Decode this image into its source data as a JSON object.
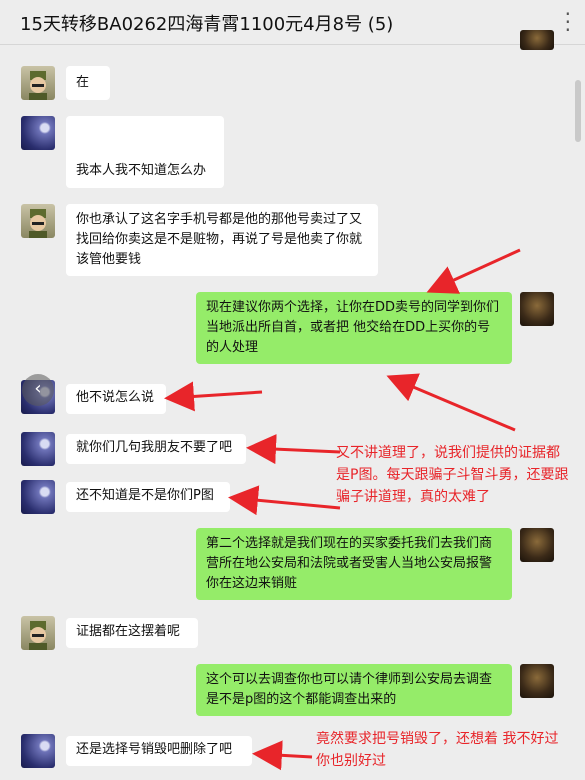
{
  "title": "15天转移BA0262四海青霄1100元4月8号 (5)",
  "menu_icon": "more-dots-icon",
  "messages": [
    {
      "side": "left",
      "text": "在"
    },
    {
      "side": "left",
      "text": "我本人我不知道怎么办"
    },
    {
      "side": "left",
      "text": "你也承认了这名字手机号都是他的那他号卖过了又找回给你卖这是不是赃物，再说了号是他卖了你就该管他要钱"
    },
    {
      "side": "right",
      "text": "现在建议你两个选择，让你在DD卖号的同学到你们当地派出所自首，或者把 他交给在DD上买你的号的人处理"
    },
    {
      "side": "left",
      "text": "他不说怎么说"
    },
    {
      "side": "left",
      "text": "就你们几句我朋友不要了吧"
    },
    {
      "side": "left",
      "text": "还不知道是不是你们P图"
    },
    {
      "side": "right",
      "text": "第二个选择就是我们现在的买家委托我们去我们商营所在地公安局和法院或者受害人当地公安局报警你在这边来销赃"
    },
    {
      "side": "left",
      "text": "证据都在这摆着呢"
    },
    {
      "side": "right",
      "text": "这个可以去调查你也可以请个律师到公安局去调查是不是p图的这个都能调查出来的"
    },
    {
      "side": "left",
      "text": "还是选择号销毁吧删除了吧"
    }
  ],
  "annotations": [
    "又不讲道理了，说我们提供的证据都是P图。每天跟骗子斗智斗勇，还要跟骗子讲道理，真的太难了",
    "竟然要求把号销毁了，还想着 我不好过你也别好过"
  ],
  "colors": {
    "annotation": "#e8252a",
    "bubble_right": "#95ec69",
    "bubble_left": "#ffffff",
    "background": "#ededed"
  }
}
